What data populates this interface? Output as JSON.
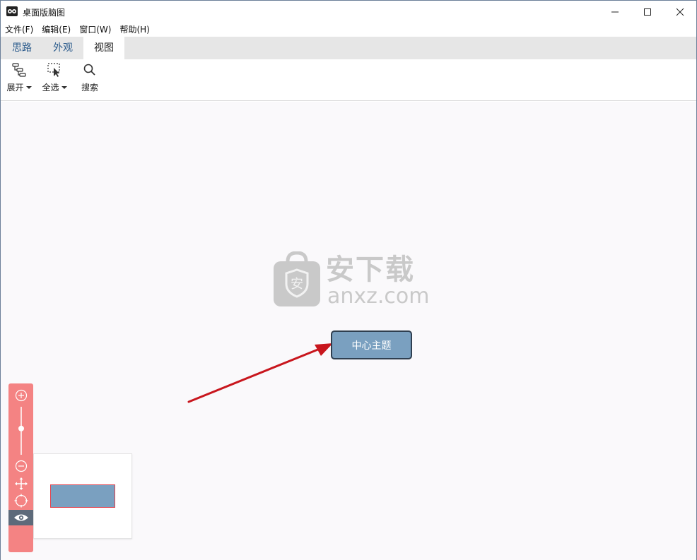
{
  "window": {
    "title": "桌面版脑图"
  },
  "menu": {
    "items": [
      "文件(F)",
      "编辑(E)",
      "窗口(W)",
      "帮助(H)"
    ]
  },
  "tabs": {
    "items": [
      {
        "label": "思路",
        "active": false
      },
      {
        "label": "外观",
        "active": false
      },
      {
        "label": "视图",
        "active": true
      }
    ]
  },
  "toolbar": {
    "expand_label": "展开",
    "select_all_label": "全选",
    "search_label": "搜索"
  },
  "canvas": {
    "central_topic": "中心主题",
    "watermark_main": "安下载",
    "watermark_sub": "anxz.com",
    "watermark_shield_text": "安"
  },
  "zoom_panel": {
    "zoom_level": 0.55
  },
  "colors": {
    "topic_fill": "#7aa0c0",
    "topic_border": "#2f3f50",
    "zoom_panel": "#f48383",
    "arrow": "#c8161d",
    "active_tab_text": "#222222",
    "tab_text": "#2b5b8c"
  }
}
